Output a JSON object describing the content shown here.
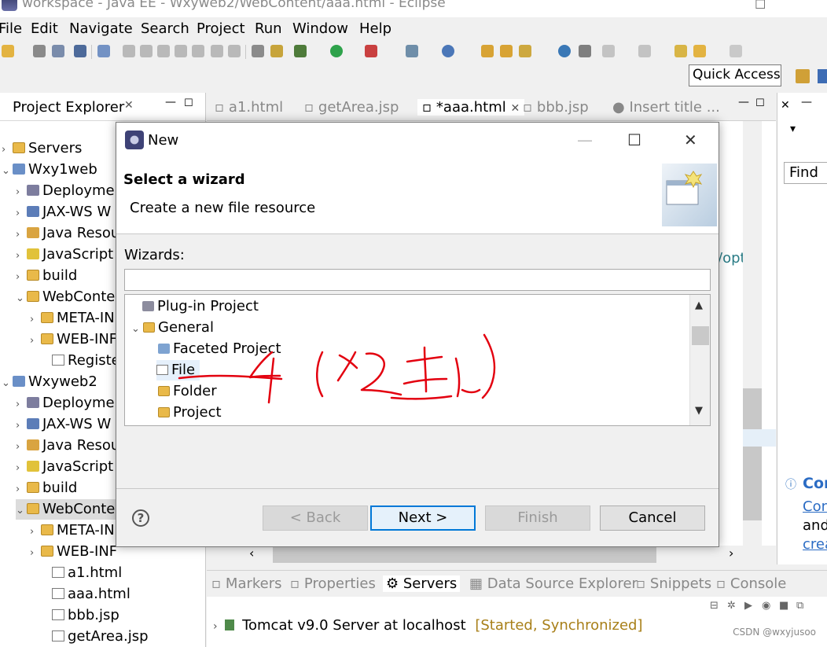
{
  "window": {
    "title": "workspace - Java EE - Wxyweb2/WebContent/aaa.html - Eclipse"
  },
  "menu": [
    "File",
    "Edit",
    "Navigate",
    "Search",
    "Project",
    "Run",
    "Window",
    "Help"
  ],
  "toolbar": {
    "quick_access": "Quick Access"
  },
  "project_explorer": {
    "title": "Project Explorer",
    "items": [
      "Servers",
      "Wxy1web",
      "Deploymer",
      "JAX-WS W",
      "Java Resou",
      "JavaScript",
      "build",
      "WebConte",
      "META-IN",
      "WEB-INF",
      "Registe.h",
      "Wxyweb2",
      "Deploymer",
      "JAX-WS W",
      "Java Resou",
      "JavaScript",
      "build",
      "WebConte",
      "META-IN",
      "WEB-INF",
      "a1.html",
      "aaa.html",
      "bbb.jsp",
      "getArea.jsp"
    ]
  },
  "editor_tabs": [
    "a1.html",
    "getArea.jsp",
    "*aaa.html",
    "bbb.jsp",
    "Insert title ..."
  ],
  "editor_fragment": "/opt",
  "right_pane": {
    "find": "Find",
    "con": "Con",
    "con2": "Con",
    "and": "and",
    "crea": "crea"
  },
  "bottom_tabs": [
    "Markers",
    "Properties",
    "Servers",
    "Data Source Explorer",
    "Snippets",
    "Console"
  ],
  "server": {
    "name": "Tomcat v9.0 Server at localhost",
    "status": "[Started, Synchronized]"
  },
  "dialog": {
    "title": "New",
    "header": "Select a wizard",
    "subheader": "Create a new file resource",
    "wizards_label": "Wizards:",
    "filter_value": "",
    "tree": [
      "Plug-in Project",
      "General",
      "Faceted Project",
      "File",
      "Folder",
      "Project"
    ],
    "buttons": {
      "back": "< Back",
      "next": "Next >",
      "finish": "Finish",
      "cancel": "Cancel"
    },
    "help": "?"
  },
  "watermark": "CSDN @wxyjusoo",
  "colors": {
    "accent": "#0078d7",
    "annotation": "#e3000f",
    "status": "#a87f18"
  }
}
